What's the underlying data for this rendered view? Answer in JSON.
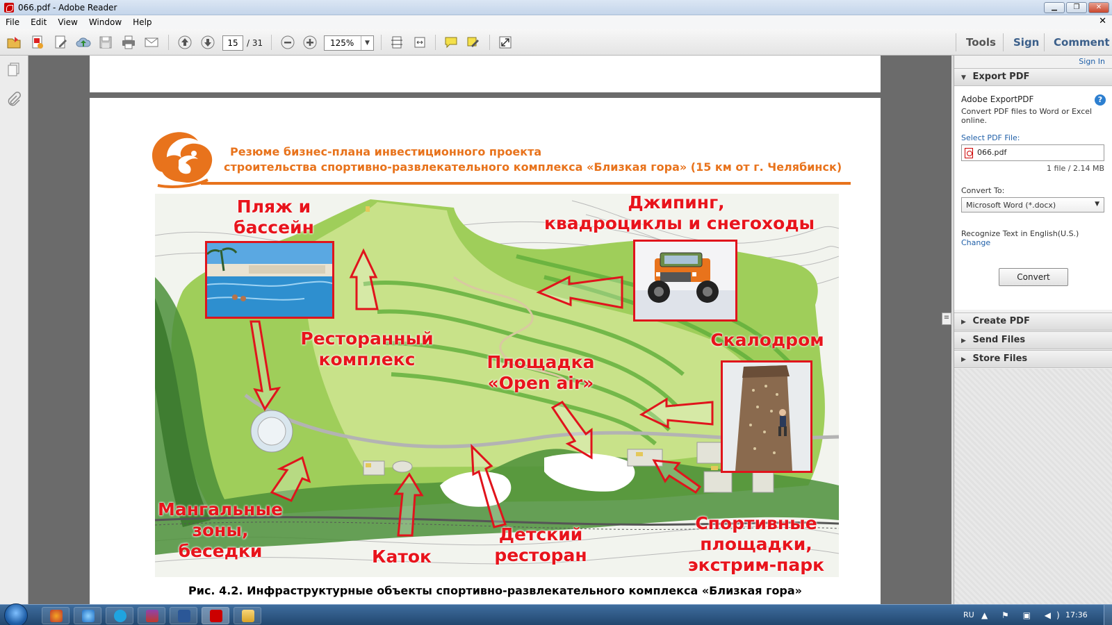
{
  "window": {
    "title": "066.pdf - Adobe Reader",
    "min_label": "▁",
    "max_label": "❐",
    "close_label": "✕"
  },
  "menu": {
    "items": [
      "File",
      "Edit",
      "View",
      "Window",
      "Help"
    ],
    "close_glyph": "✕"
  },
  "toolbar": {
    "page_current": "15",
    "page_total": "/ 31",
    "zoom": "125%",
    "zoom_dropdown": "▼",
    "tabs": {
      "tools": "Tools",
      "sign": "Sign",
      "comment": "Comment"
    }
  },
  "document": {
    "header_line1": "Резюме бизнес-плана инвестиционного проекта",
    "header_line2": "строительства спортивно-развлекательного комплекса «Близкая гора» (15 км от г. Челябинск)",
    "labels": {
      "beach_1": "Пляж и",
      "beach_2": "бассейн",
      "jeeping_1": "Джипинг,",
      "jeeping_2": "квадроциклы и снегоходы",
      "restaurant_1": "Ресторанный",
      "restaurant_2": "комплекс",
      "climbing": "Скалодром",
      "openair_1": "Площадка",
      "openair_2": "«Open air»",
      "bbq_1": "Мангальные",
      "bbq_2": "зоны,",
      "bbq_3": "беседки",
      "rink": "Каток",
      "kids_1": "Детский",
      "kids_2": "ресторан",
      "sports_1": "Спортивные",
      "sports_2": "площадки,",
      "sports_3": "экстрим-парк"
    },
    "caption": "Рис. 4.2. Инфраструктурные объекты спортивно-развлекательного комплекса «Близкая гора»"
  },
  "right_pane": {
    "sign_in": "Sign In",
    "export_header": "Export PDF",
    "export_title": "Adobe ExportPDF",
    "export_help": "?",
    "export_desc": "Convert PDF files to Word or Excel online.",
    "select_label": "Select PDF File:",
    "file_name": "066.pdf",
    "file_meta": "1 file / 2.14 MB",
    "convert_to_label": "Convert To:",
    "convert_to_value": "Microsoft Word (*.docx)",
    "convert_to_dropdown": "▼",
    "recognize_text": "Recognize Text in English(U.S.)",
    "change_link": "Change",
    "convert_button": "Convert",
    "sections": [
      "Create PDF",
      "Send Files",
      "Store Files"
    ],
    "expanded_arrow": "▼",
    "collapsed_arrow": "▶"
  },
  "taskbar": {
    "lang": "RU",
    "tray_icons": "▲ ⚑ ▣ ◀)",
    "clock": "17:36"
  },
  "colors": {
    "accent_orange": "#e8731c",
    "label_red": "#e8141c",
    "map_green": "#8fc24a"
  },
  "icons": [
    "open-icon",
    "create-icon",
    "edit-icon",
    "upload-icon",
    "save-icon",
    "print-icon",
    "email-icon",
    "prev-page-icon",
    "next-page-icon",
    "zoom-out-icon",
    "zoom-in-icon",
    "fit-page-icon",
    "fit-width-icon",
    "comment-icon",
    "highlight-icon",
    "read-mode-icon"
  ]
}
